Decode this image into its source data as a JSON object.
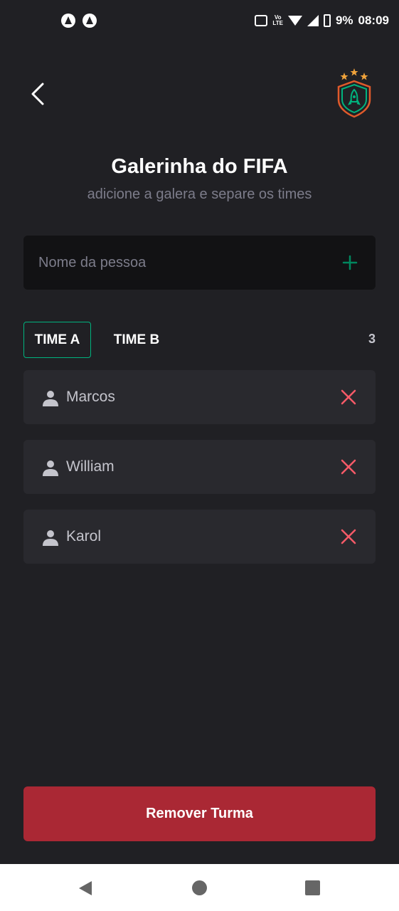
{
  "status_bar": {
    "battery": "9%",
    "time": "08:09",
    "network": "LTE",
    "volte": "Vo"
  },
  "header": {
    "back_icon": "chevron-left-icon",
    "logo_icon": "rocket-shield-logo"
  },
  "page": {
    "title": "Galerinha do FIFA",
    "subtitle": "adicione a galera e separe os times"
  },
  "input": {
    "placeholder": "Nome da pessoa",
    "value": "",
    "add_icon": "plus-icon"
  },
  "tabs": [
    {
      "label": "TIME A",
      "active": true
    },
    {
      "label": "TIME B",
      "active": false
    }
  ],
  "player_count": "3",
  "players": [
    {
      "name": "Marcos"
    },
    {
      "name": "William"
    },
    {
      "name": "Karol"
    }
  ],
  "actions": {
    "remove_group_label": "Remover Turma"
  },
  "colors": {
    "background": "#202024",
    "card": "#29292e",
    "input": "#121214",
    "accent_green": "#00b37e",
    "danger_red": "#aa2834",
    "remove_icon_red": "#f75a68"
  }
}
